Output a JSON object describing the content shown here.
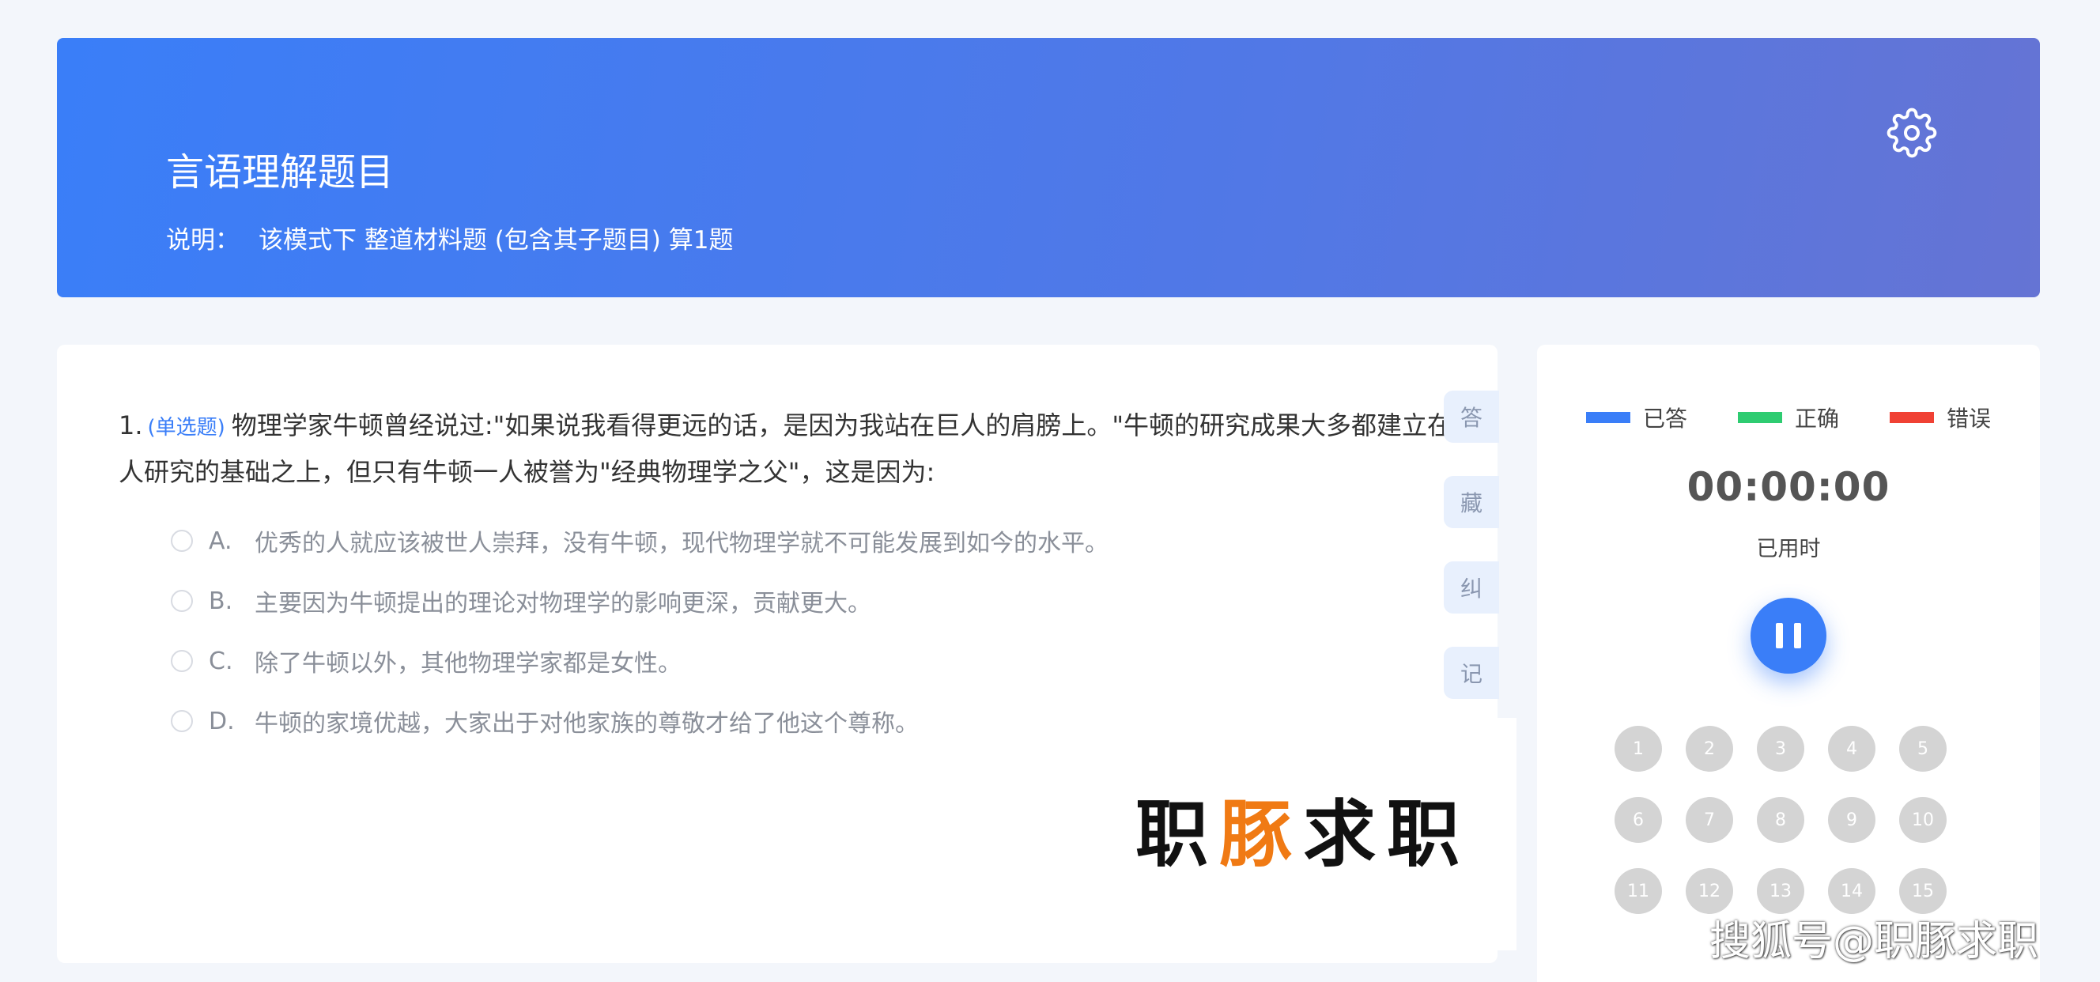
{
  "header": {
    "title": "言语理解题目",
    "note_label": "说明：",
    "note_text": "该模式下 整道材料题 (包含其子题目) 算1题",
    "settings_icon": "gear-icon"
  },
  "question": {
    "number": "1.",
    "type_label": "(单选题)",
    "text": "物理学家牛顿曾经说过:\"如果说我看得更远的话，是因为我站在巨人的肩膀上。\"牛顿的研究成果大多都建立在前人研究的基础之上，但只有牛顿一人被誉为\"经典物理学之父\"，这是因为:",
    "options": [
      {
        "letter": "A.",
        "text": "优秀的人就应该被世人崇拜，没有牛顿，现代物理学就不可能发展到如今的水平。"
      },
      {
        "letter": "B.",
        "text": "主要因为牛顿提出的理论对物理学的影响更深，贡献更大。"
      },
      {
        "letter": "C.",
        "text": "除了牛顿以外，其他物理学家都是女性。"
      },
      {
        "letter": "D.",
        "text": "牛顿的家境优越，大家出于对他家族的尊敬才给了他这个尊称。"
      }
    ]
  },
  "side_tools": [
    "答",
    "藏",
    "纠",
    "记"
  ],
  "logo": {
    "part1": "职",
    "part2": "豚",
    "part3": "求职"
  },
  "panel": {
    "legend": [
      {
        "label": "已答",
        "color": "#3a7ef8"
      },
      {
        "label": "正确",
        "color": "#2ecc71"
      },
      {
        "label": "错误",
        "color": "#f04134"
      }
    ],
    "timer": "00:00:00",
    "timer_label": "已用时",
    "pause_icon": "pause-icon",
    "question_numbers": [
      "1",
      "2",
      "3",
      "4",
      "5",
      "6",
      "7",
      "8",
      "9",
      "10",
      "11",
      "12",
      "13",
      "14",
      "15"
    ]
  },
  "watermark": "搜狐号@职豚求职"
}
